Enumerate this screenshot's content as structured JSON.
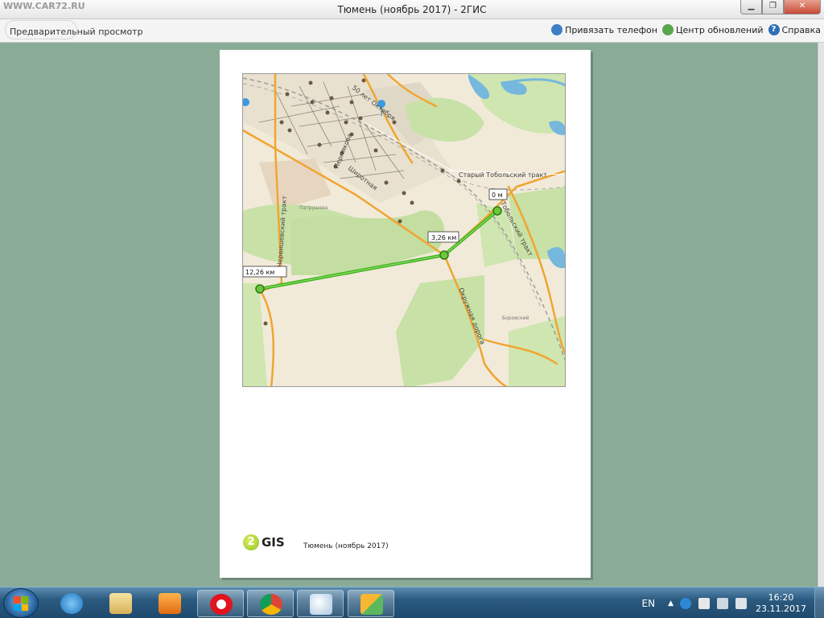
{
  "window": {
    "watermark": "WWW.CAR72.RU",
    "title": "Тюмень (ноябрь 2017) - 2ГИС",
    "minimize_icon": "minimize-icon",
    "maximize_icon": "maximize-icon",
    "close_icon": "close-icon",
    "close_label": "✕",
    "minimize_label": "▁",
    "maximize_label": "❐"
  },
  "toolbar": {
    "left_label": "Предварительный просмотр",
    "bind_phone": "Привязать телефон",
    "update_center": "Центр обновлений",
    "help": "Справка",
    "help_glyph": "?"
  },
  "map": {
    "streets": [
      "50 лет Октября",
      "Пермякова",
      "Широтная",
      "Старый Тобольский тракт",
      "Червишевский тракт",
      "Окружная дорога",
      "Тобольский тракт"
    ],
    "ruler_labels": [
      "0 м",
      "3,26 км",
      "12,26 км"
    ],
    "district_labels": [
      "Боровский",
      "Патрушева"
    ]
  },
  "page_footer": {
    "logo_number": "2",
    "logo_text": "GIS",
    "caption": "Тюмень (ноябрь 2017)"
  },
  "taskbar": {
    "apps": [
      "start-orb",
      "internet-explorer-icon",
      "file-explorer-icon",
      "media-player-icon",
      "opera-icon",
      "chrome-icon",
      "paint-icon",
      "2gis-icon"
    ],
    "lang": "EN",
    "tray_arrow": "▲",
    "time": "16:20",
    "date": "23.11.2017"
  },
  "colors": {
    "desktop_bg": "#8aab96",
    "route_green": "#3cb019",
    "road_orange": "#f0a531",
    "park_green": "#c8e1a7",
    "water_blue": "#76b7dd"
  }
}
